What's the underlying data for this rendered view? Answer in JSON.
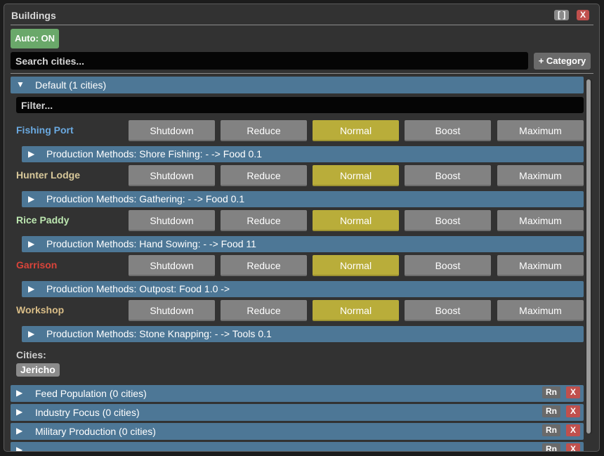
{
  "window": {
    "title": "Buildings",
    "maximize_label": "[ ]",
    "close_label": "X"
  },
  "toolbar": {
    "auto_label": "Auto: ON",
    "search_placeholder": "Search cities...",
    "category_label": "+ Category"
  },
  "default_group": {
    "label": "Default (1 cities)",
    "filter_placeholder": "Filter...",
    "levels": [
      "Shutdown",
      "Reduce",
      "Normal",
      "Boost",
      "Maximum"
    ],
    "active_level": "Normal",
    "buildings": [
      {
        "name": "Fishing Port",
        "color": "#6aa9e0",
        "production": "Production Methods: Shore Fishing: - -> Food 0.1"
      },
      {
        "name": "Hunter Lodge",
        "color": "#d8c89a",
        "production": "Production Methods: Gathering: - -> Food 0.1"
      },
      {
        "name": "Rice Paddy",
        "color": "#bce6b0",
        "production": "Production Methods: Hand Sowing: - -> Food 11"
      },
      {
        "name": "Garrison",
        "color": "#d9443a",
        "production": "Production Methods: Outpost: Food 1.0 ->"
      },
      {
        "name": "Workshop",
        "color": "#d9bd87",
        "production": "Production Methods: Stone Knapping: - -> Tools 0.1"
      }
    ],
    "cities_label": "Cities:",
    "cities": [
      "Jericho"
    ]
  },
  "other_groups": [
    {
      "label": "Feed Population (0 cities)",
      "rename_label": "Rn",
      "delete_label": "X"
    },
    {
      "label": "Industry Focus (0 cities)",
      "rename_label": "Rn",
      "delete_label": "X"
    },
    {
      "label": "Military Production (0 cities)",
      "rename_label": "Rn",
      "delete_label": "X"
    },
    {
      "label": "",
      "rename_label": "Rn",
      "delete_label": "X"
    }
  ],
  "icons": {
    "expanded": "triangle-down-icon",
    "collapsed": "triangle-right-icon"
  }
}
